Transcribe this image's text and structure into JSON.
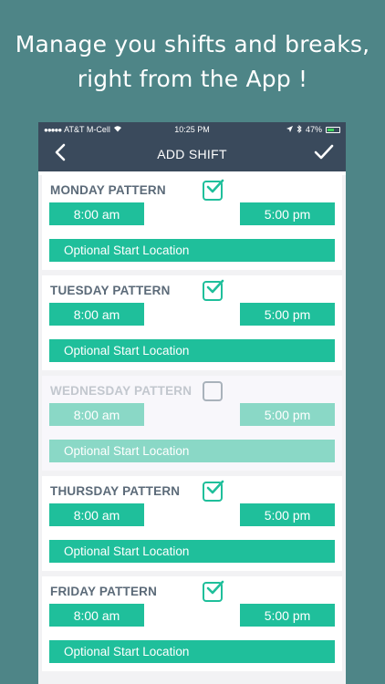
{
  "headline": {
    "line1": "Manage you shifts and breaks,",
    "line2": "right from the App !"
  },
  "status_bar": {
    "signal": "●●●●●",
    "carrier": "AT&T M-Cell",
    "time": "10:25 PM",
    "battery": "47%"
  },
  "nav": {
    "title": "ADD SHIFT",
    "back_icon": "chevron-left-icon",
    "confirm_icon": "checkmark-icon"
  },
  "days": [
    {
      "title": "MONDAY PATTERN",
      "checked": true,
      "start": "8:00 am",
      "end": "5:00 pm",
      "location": "Optional Start Location"
    },
    {
      "title": "TUESDAY PATTERN",
      "checked": true,
      "start": "8:00 am",
      "end": "5:00 pm",
      "location": "Optional Start Location"
    },
    {
      "title": "WEDNESDAY PATTERN",
      "checked": false,
      "start": "8:00 am",
      "end": "5:00 pm",
      "location": "Optional Start Location"
    },
    {
      "title": "THURSDAY PATTERN",
      "checked": true,
      "start": "8:00 am",
      "end": "5:00 pm",
      "location": "Optional Start Location"
    },
    {
      "title": "FRIDAY PATTERN",
      "checked": true,
      "start": "8:00 am",
      "end": "5:00 pm",
      "location": "Optional Start Location"
    }
  ],
  "colors": {
    "background": "#4e8587",
    "nav": "#3a4a5c",
    "accent": "#1fbf9b",
    "accent_disabled": "#8ad8c6"
  }
}
